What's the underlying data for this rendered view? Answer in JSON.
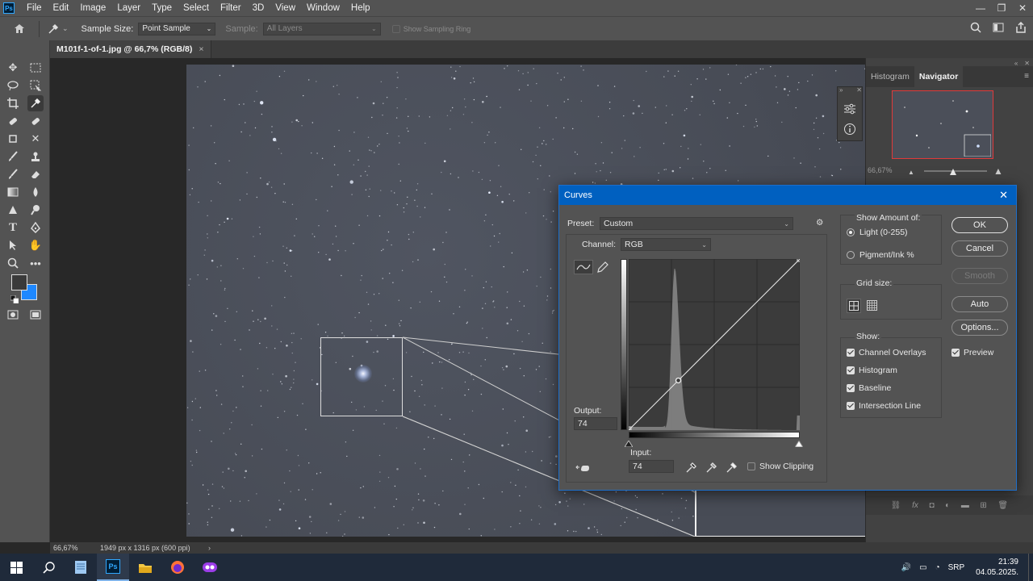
{
  "menu": {
    "logo": "Ps",
    "items": [
      "File",
      "Edit",
      "Image",
      "Layer",
      "Type",
      "Select",
      "Filter",
      "3D",
      "View",
      "Window",
      "Help"
    ]
  },
  "options_bar": {
    "sample_size_label": "Sample Size:",
    "sample_size_value": "Point Sample",
    "sample_label": "Sample:",
    "sample_value": "All Layers",
    "show_sampling_ring": "Show Sampling Ring"
  },
  "document_tab": {
    "title": "M101f-1-of-1.jpg @ 66,7% (RGB/8)",
    "close": "×"
  },
  "status_bar": {
    "zoom": "66,67%",
    "doc_info": "1949 px x 1316 px (600 ppi)"
  },
  "right_panel": {
    "tabs": [
      "Histogram",
      "Navigator"
    ],
    "active_tab": "Navigator",
    "zoom_value": "66,67%"
  },
  "curves": {
    "title": "Curves",
    "preset_label": "Preset:",
    "preset_value": "Custom",
    "channel_label": "Channel:",
    "channel_value": "RGB",
    "output_label": "Output:",
    "output_value": "74",
    "input_label": "Input:",
    "input_value": "74",
    "show_clipping": "Show Clipping",
    "show_amount_label": "Show Amount of:",
    "light_option": "Light  (0-255)",
    "pigment_option": "Pigment/Ink %",
    "grid_size_label": "Grid size:",
    "show_label": "Show:",
    "show_options": [
      "Channel Overlays",
      "Histogram",
      "Baseline",
      "Intersection Line"
    ],
    "buttons": {
      "ok": "OK",
      "cancel": "Cancel",
      "smooth": "Smooth",
      "auto": "Auto",
      "options": "Options..."
    },
    "preview_label": "Preview",
    "curve_point": {
      "input": 74,
      "output": 74
    }
  },
  "taskbar": {
    "language": "SRP",
    "time": "21:39",
    "date": "04.05.2025."
  },
  "colors": {
    "chrome": "#535353",
    "dialog_title": "#0060c0",
    "foreground_swatch": "#3a3a3a",
    "background_swatch": "#1e88ff"
  }
}
